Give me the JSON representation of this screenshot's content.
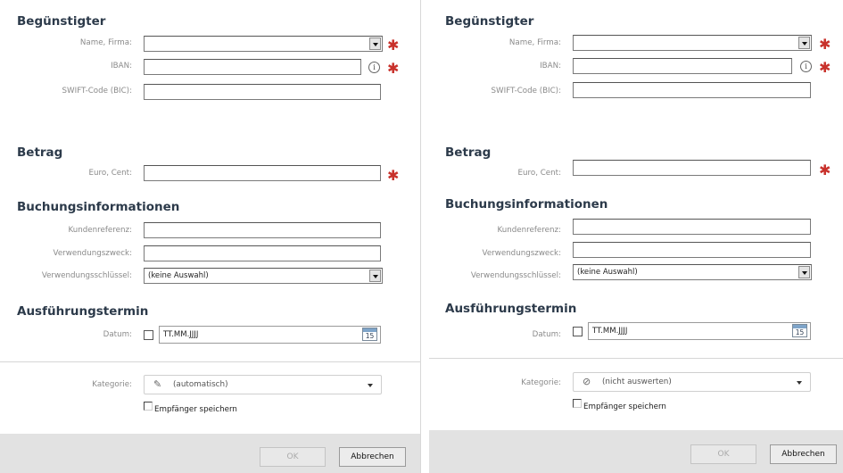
{
  "left": {
    "beneficiary": {
      "heading": "Begünstigter",
      "name_label": "Name, Firma:",
      "iban_label": "IBAN:",
      "swift_label": "SWIFT-Code (BIC):"
    },
    "amount": {
      "heading": "Betrag",
      "euro_label": "Euro, Cent:"
    },
    "booking": {
      "heading": "Buchungsinformationen",
      "customer_ref_label": "Kundenreferenz:",
      "purpose_label": "Verwendungszweck:",
      "key_label": "Verwendungsschlüssel:",
      "key_value": "(keine Auswahl)"
    },
    "execution": {
      "heading": "Ausführungstermin",
      "date_label": "Datum:",
      "date_placeholder": "TT.MM.JJJJ",
      "calendar_day": "15"
    },
    "category": {
      "label": "Kategorie:",
      "value": "(automatisch)"
    },
    "save_recipient_label": "Empfänger speichern",
    "ok_label": "OK",
    "cancel_label": "Abbrechen"
  },
  "right": {
    "beneficiary": {
      "heading": "Begünstigter",
      "name_label": "Name, Firma:",
      "iban_label": "IBAN:",
      "swift_label": "SWIFT-Code (BIC):"
    },
    "amount": {
      "heading": "Betrag",
      "euro_label": "Euro, Cent:"
    },
    "booking": {
      "heading": "Buchungsinformationen",
      "customer_ref_label": "Kundenreferenz:",
      "purpose_label": "Verwendungszweck:",
      "key_label": "Verwendungsschlüssel:",
      "key_value": "(keine Auswahl)"
    },
    "execution": {
      "heading": "Ausführungstermin",
      "date_label": "Datum:",
      "date_placeholder": "TT.MM.JJJJ",
      "calendar_day": "15"
    },
    "category": {
      "label": "Kategorie:",
      "value": "(nicht auswerten)"
    },
    "save_recipient_label": "Empfänger speichern",
    "ok_label": "OK",
    "cancel_label": "Abbrechen"
  },
  "icons": {
    "required": "asterisk-icon",
    "info": "info-icon",
    "calendar": "calendar-icon",
    "auto_category": "magic-wand-icon",
    "no_eval_category": "tag-crossed-icon"
  },
  "colors": {
    "required": "#c8312b",
    "heading": "#2c3a4a",
    "footer": "#e2e2e2"
  }
}
